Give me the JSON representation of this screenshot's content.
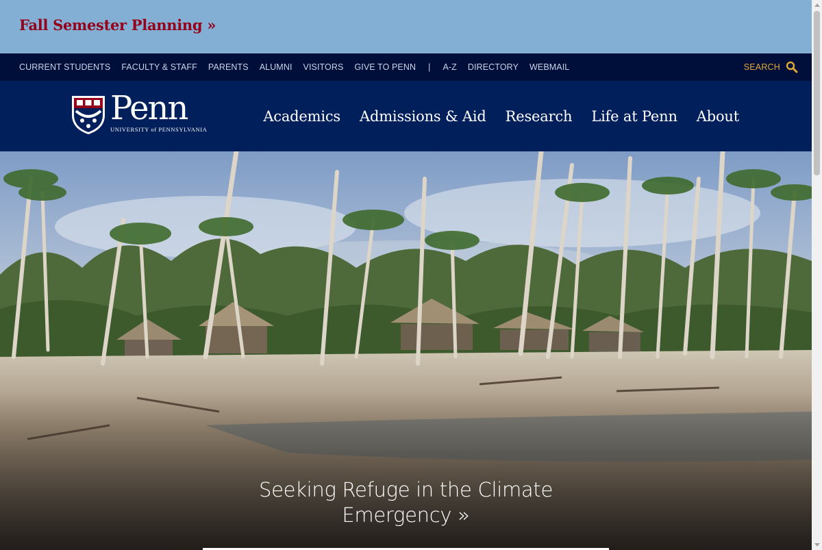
{
  "alert": {
    "label": "Fall Semester Planning »"
  },
  "utility_nav": {
    "items": [
      "CURRENT STUDENTS",
      "FACULTY & STAFF",
      "PARENTS",
      "ALUMNI",
      "VISITORS",
      "GIVE TO PENN"
    ],
    "separator": "|",
    "items_secondary": [
      "A-Z",
      "DIRECTORY",
      "WEBMAIL"
    ],
    "search_label": "SEARCH"
  },
  "logo": {
    "name": "Penn",
    "subtitle": "UNIVERSITY of PENNSYLVANIA"
  },
  "main_nav": {
    "items": [
      "Academics",
      "Admissions & Aid",
      "Research",
      "Life at Penn",
      "About"
    ]
  },
  "hero": {
    "caption": "Seeking Refuge in the Climate Emergency »"
  },
  "colors": {
    "penn_red": "#95001a",
    "penn_blue": "#011f5b",
    "utility_bg": "#000f3a",
    "alert_bg": "#82afd3",
    "search_accent": "#e0a938"
  }
}
